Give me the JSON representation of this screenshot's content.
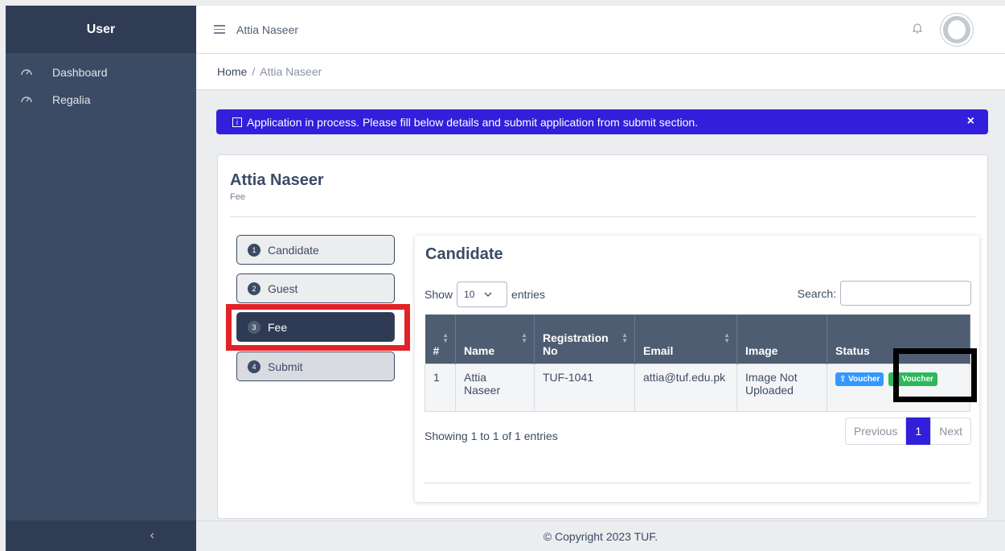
{
  "sidebar": {
    "brand": "User",
    "items": [
      {
        "label": "Dashboard",
        "icon": "speedometer-icon"
      },
      {
        "label": "Regalia",
        "icon": "speedometer-icon"
      }
    ],
    "toggler": "‹"
  },
  "header": {
    "title": "Attia Naseer"
  },
  "breadcrumb": {
    "home": "Home",
    "separator": "/",
    "current": "Attia Naseer"
  },
  "alert": {
    "message": "Application in process. Please fill below details and submit application from submit section.",
    "info_glyph": "i",
    "close": "×",
    "color": "#321fdb"
  },
  "card": {
    "title": "Attia Naseer",
    "subtitle": "Fee"
  },
  "steps": [
    {
      "num": "1",
      "label": "Candidate"
    },
    {
      "num": "2",
      "label": "Guest"
    },
    {
      "num": "3",
      "label": "Fee"
    },
    {
      "num": "4",
      "label": "Submit"
    }
  ],
  "panel": {
    "title": "Candidate",
    "show_label": "Show",
    "length_value": "10",
    "entries_label": "entries",
    "search_label": "Search:"
  },
  "table": {
    "headers": [
      "#",
      "Name",
      "Registration No",
      "Email",
      "Image",
      "Status"
    ],
    "rows": [
      {
        "num": "1",
        "name": "Attia Naseer",
        "reg": "TUF-1041",
        "email": "attia@tuf.edu.pk",
        "image": "Image Not Uploaded",
        "status_buttons": [
          "Voucher",
          "Voucher"
        ]
      }
    ]
  },
  "pagination": {
    "info": "Showing 1 to 1 of 1 entries",
    "previous": "Previous",
    "page": "1",
    "next": "Next"
  },
  "footer": {
    "text": "© Copyright 2023 TUF."
  }
}
